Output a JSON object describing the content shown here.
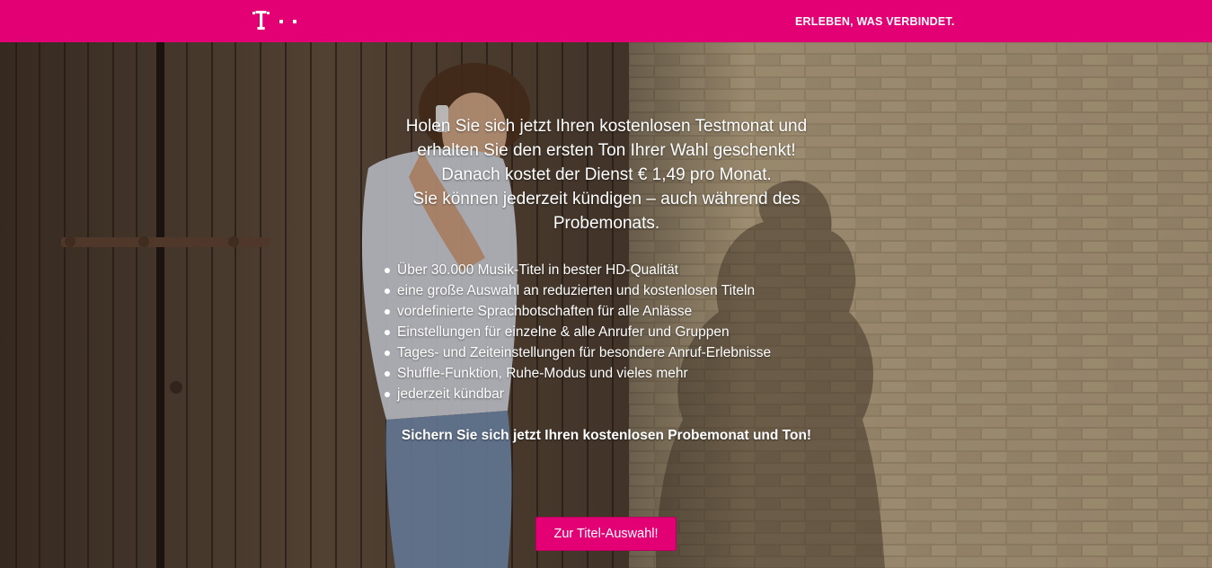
{
  "header": {
    "brand_logo": "telekom-t-logo",
    "tagline": "ERLEBEN, WAS VERBINDET."
  },
  "hero": {
    "headline_lines": [
      "Holen Sie sich jetzt Ihren kostenlosen Testmonat und",
      "erhalten Sie den ersten Ton Ihrer Wahl geschenkt!",
      "Danach kostet der Dienst € 1,49 pro Monat.",
      "Sie können jederzeit kündigen – auch während des",
      "Probemonats."
    ],
    "features": [
      "Über 30.000 Musik-Titel in bester HD-Qualität",
      "eine große Auswahl an reduzierten und kostenlosen Titeln",
      "vordefinierte Sprachbotschaften für alle Anlässe",
      "Einstellungen für einzelne & alle Anrufer und Gruppen",
      "Tages- und Zeiteinstellungen für besondere Anruf-Erlebnisse",
      "Shuffle-Funktion, Ruhe-Modus und vieles mehr",
      "jederzeit kündbar"
    ],
    "cta_text": "Sichern Sie sich jetzt Ihren kostenlosen Probemonat und Ton!",
    "cta_button": "Zur Titel-Auswahl!"
  },
  "colors": {
    "brand_magenta": "#e20074",
    "text": "#ffffff"
  }
}
